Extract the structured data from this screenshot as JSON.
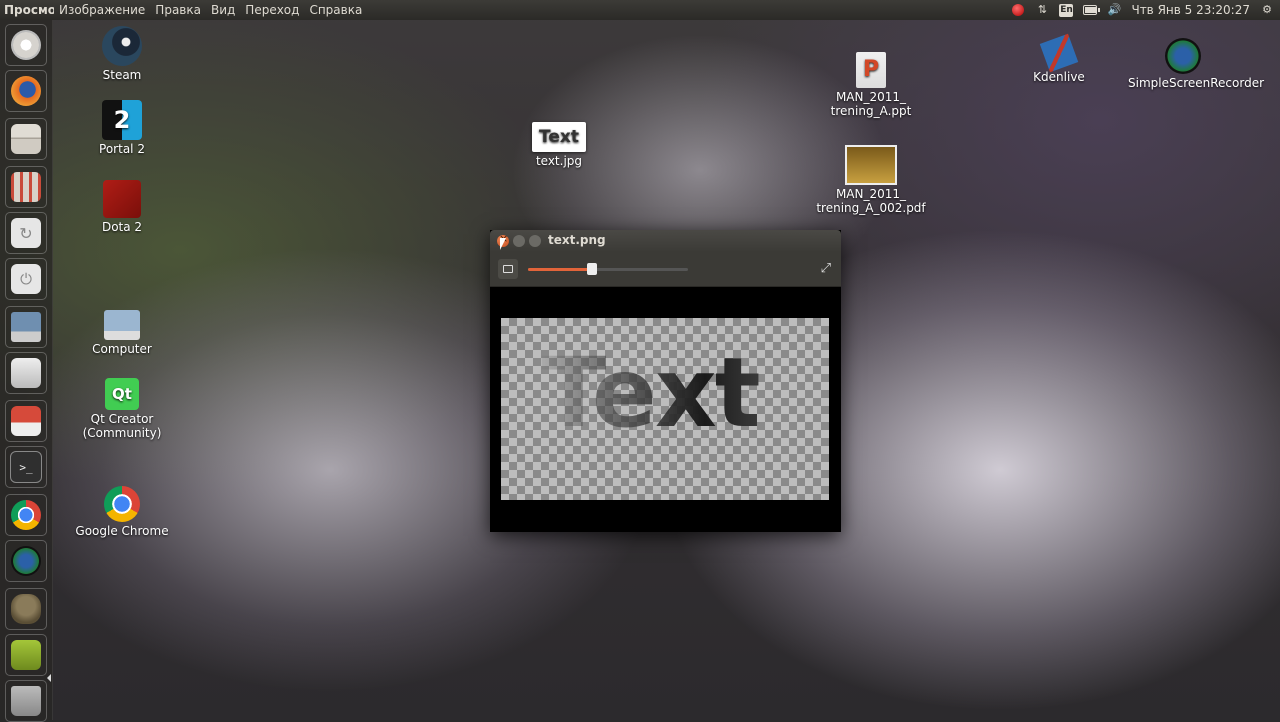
{
  "top_panel": {
    "app_name": "Просмотр",
    "menu": [
      "Изображение",
      "Правка",
      "Вид",
      "Переход",
      "Справка"
    ],
    "clock": "Чтв Янв 5 23:20:27",
    "keyboard_layout": "En",
    "icons": [
      "record-indicator-icon",
      "network-icon",
      "keyboard-layout-icon",
      "battery-icon",
      "volume-icon",
      "gear-icon"
    ]
  },
  "launcher": {
    "items": [
      {
        "name": "ubuntu-dash",
        "icon": "ubuntu-logo-icon",
        "color": "#d6d3ce"
      },
      {
        "name": "firefox",
        "icon": "firefox-icon",
        "color": "#e66a1f"
      },
      {
        "name": "files",
        "icon": "file-cabinet-icon",
        "color": "#c9c4bb"
      },
      {
        "name": "settings",
        "icon": "mixer-settings-icon",
        "color": "#b9b3aa"
      },
      {
        "name": "update",
        "icon": "refresh-icon",
        "color": "#e6e6e6"
      },
      {
        "name": "shutdown",
        "icon": "power-icon",
        "color": "#e6e6e6"
      },
      {
        "name": "remote-desktop",
        "icon": "monitor-icon",
        "color": "#b8c4d0"
      },
      {
        "name": "system-tools",
        "icon": "tools-icon",
        "color": "#cfcfcf"
      },
      {
        "name": "installer",
        "icon": "install-icon",
        "color": "#c0392b"
      },
      {
        "name": "terminal",
        "icon": "terminal-icon",
        "color": "#2f2f2f"
      },
      {
        "name": "chrome",
        "icon": "chrome-icon",
        "color": "#4285f4"
      },
      {
        "name": "screen-recorder",
        "icon": "screen-recorder-icon",
        "color": "#1f7a3a"
      },
      {
        "name": "gimp",
        "icon": "gimp-icon",
        "color": "#8a7b5a"
      },
      {
        "name": "image-viewer",
        "icon": "image-viewer-icon",
        "color": "#a4c639"
      },
      {
        "name": "trash",
        "icon": "trash-icon",
        "color": "#9a9a9a"
      }
    ]
  },
  "desktop": {
    "icons": [
      {
        "label": "Steam",
        "icon": "steam-icon"
      },
      {
        "label": "Portal 2",
        "icon": "portal2-icon"
      },
      {
        "label": "Dota 2",
        "icon": "dota2-icon"
      },
      {
        "label": "Computer",
        "icon": "computer-icon"
      },
      {
        "label": "Qt Creator (Community)",
        "icon": "qt-creator-icon"
      },
      {
        "label": "Google Chrome",
        "icon": "chrome-icon"
      },
      {
        "label": "text.jpg",
        "icon": "image-file-icon",
        "thumb_text": "Text"
      },
      {
        "label": "MAN_2011_ trening_A.ppt",
        "icon": "ppt-file-icon"
      },
      {
        "label": "MAN_2011_ trening_A_002.pdf",
        "icon": "pdf-file-icon"
      },
      {
        "label": "Kdenlive",
        "icon": "kdenlive-icon"
      },
      {
        "label": "SimpleScreenRecorder",
        "icon": "screen-recorder-icon"
      }
    ]
  },
  "viewer": {
    "title": "text.png",
    "zoom_fraction": 0.4,
    "image_text": "Text"
  }
}
